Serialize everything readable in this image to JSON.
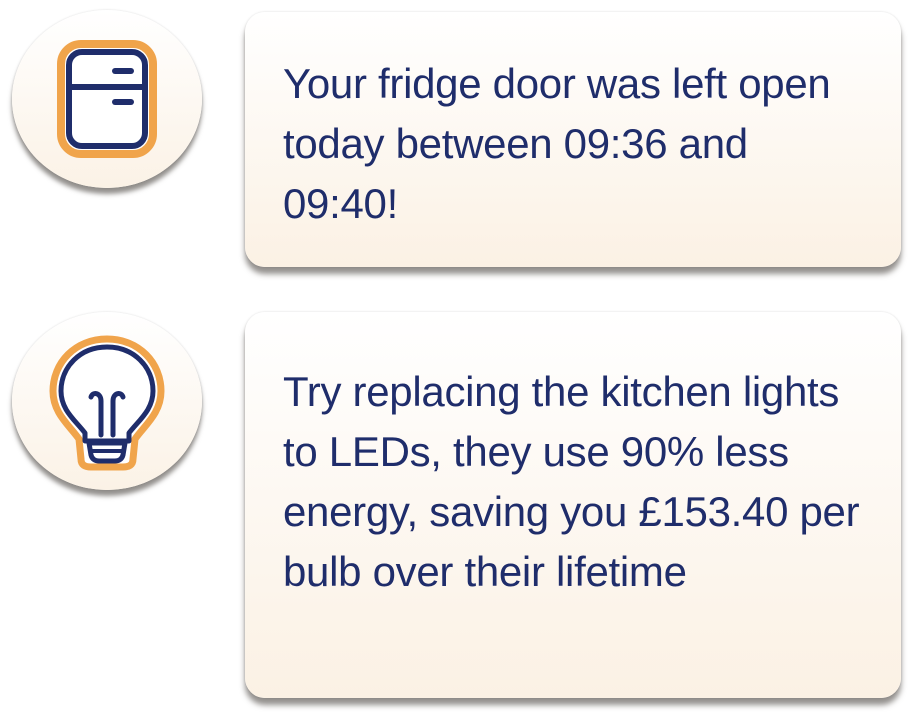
{
  "notifications": [
    {
      "icon": "fridge-icon",
      "message": "Your fridge door was left open today between 09:36 and 09:40!"
    },
    {
      "icon": "lightbulb-icon",
      "message": "Try replacing the kitchen lights to LEDs, they use 90% less energy, saving you £153.40 per bulb over their lifetime"
    }
  ],
  "colors": {
    "text": "#1f2d6b",
    "icon_stroke": "#1f2d6b",
    "icon_accent": "#f0a44b",
    "card_bg_top": "#ffffff",
    "card_bg_bottom": "#fbf1e4"
  }
}
